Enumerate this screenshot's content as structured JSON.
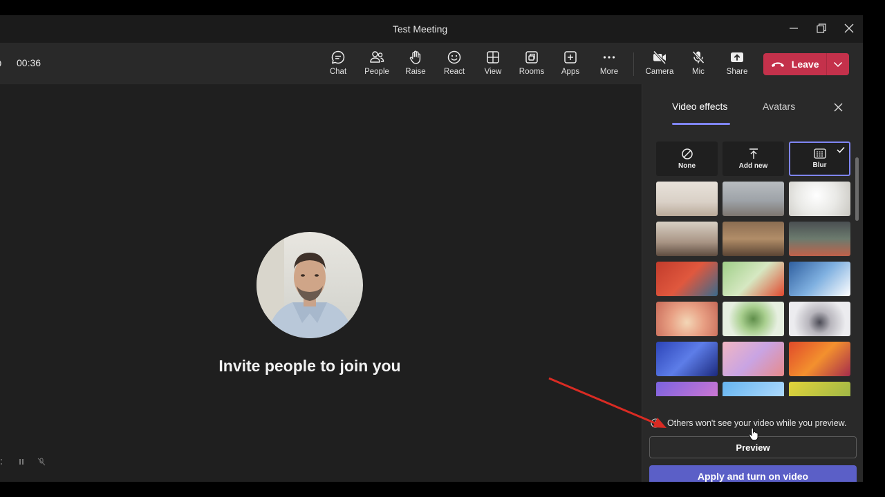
{
  "window": {
    "title": "Test Meeting",
    "controls": [
      "minimize-icon",
      "restore-icon",
      "close-icon"
    ]
  },
  "toolbar": {
    "timer": "00:36",
    "buttons": [
      {
        "label": "Chat",
        "icon": "chat-icon"
      },
      {
        "label": "People",
        "icon": "people-icon"
      },
      {
        "label": "Raise",
        "icon": "hand-icon"
      },
      {
        "label": "React",
        "icon": "smiley-icon"
      },
      {
        "label": "View",
        "icon": "grid-icon"
      },
      {
        "label": "Rooms",
        "icon": "rooms-icon"
      },
      {
        "label": "Apps",
        "icon": "plus-box-icon"
      },
      {
        "label": "More",
        "icon": "more-icon"
      },
      {
        "label": "Camera",
        "icon": "camera-off-icon"
      },
      {
        "label": "Mic",
        "icon": "mic-off-icon"
      },
      {
        "label": "Share",
        "icon": "share-icon"
      }
    ],
    "leave_label": "Leave"
  },
  "stage": {
    "invite_text": "Invite people to join you"
  },
  "panel": {
    "tabs": [
      "Video effects",
      "Avatars"
    ],
    "active_tab": "Video effects",
    "options": [
      {
        "label": "None",
        "icon": "none-icon"
      },
      {
        "label": "Add new",
        "icon": "upload-icon"
      },
      {
        "label": "Blur",
        "icon": "blur-icon",
        "selected": true
      }
    ],
    "notice": "Others won't see your video while you preview.",
    "preview_label": "Preview",
    "apply_label": "Apply and turn on video"
  },
  "colors": {
    "accent": "#7f85f5",
    "leave": "#c4314b",
    "apply": "#5b5fc7",
    "background": "#1f1f1f",
    "toolbar": "#292929"
  }
}
